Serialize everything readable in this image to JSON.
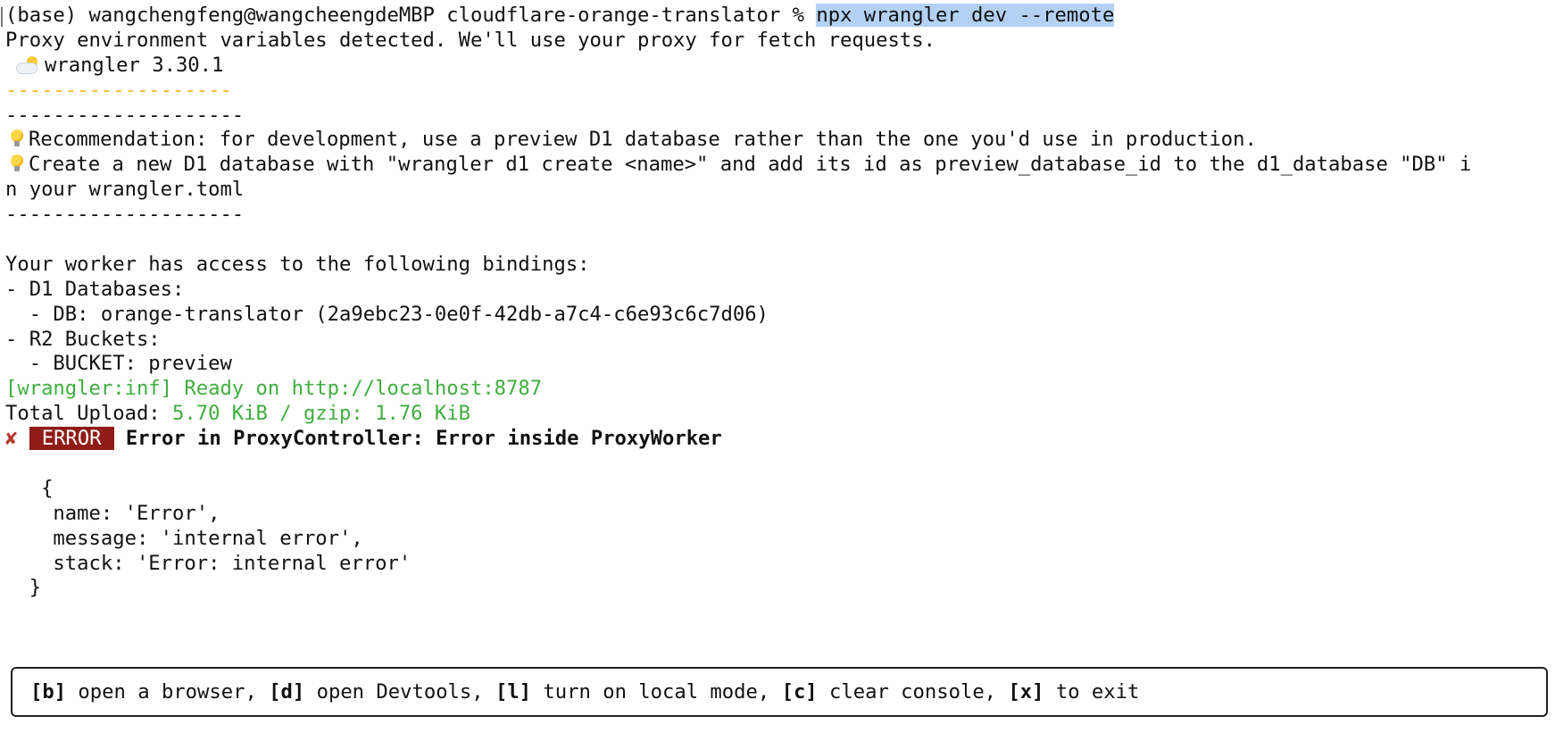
{
  "terminal": {
    "prompt": "(base) wangchengfeng@wangcheengdeMBP cloudflare-orange-translator % ",
    "command": "npx wrangler dev --remote",
    "proxy_notice": "Proxy environment variables detected. We'll use your proxy for fetch requests.",
    "wrangler_version": "wrangler 3.30.1",
    "divider_orange": "-------------------",
    "divider": "--------------------",
    "recommendation_1": "Recommendation: for development, use a preview D1 database rather than the one you'd use in production.",
    "recommendation_2a": "Create a new D1 database with \"wrangler d1 create <name>\" and add its id as preview_database_id to the d1_database \"DB\" i",
    "recommendation_2b": "n your wrangler.toml",
    "bindings_heading": "Your worker has access to the following bindings:",
    "d1_heading": "- D1 Databases:",
    "d1_item": "  - DB: orange-translator (2a9ebc23-0e0f-42db-a7c4-c6e93c6c7d06)",
    "r2_heading": "- R2 Buckets:",
    "r2_item": "  - BUCKET: preview",
    "ready_line": "[wrangler:inf] Ready on http://localhost:8787",
    "upload_label": "Total Upload: ",
    "upload_value": "5.70 KiB / gzip: 1.76 KiB",
    "error_mark": "✘",
    "error_badge": "ERROR",
    "error_message": "Error in ProxyController: Error inside ProxyWorker",
    "obj_open": "   {",
    "obj_name": "    name: 'Error',",
    "obj_message": "    message: 'internal error',",
    "obj_stack": "    stack: 'Error: internal error'",
    "obj_close": "  }"
  },
  "shortcuts": [
    {
      "key": "[b]",
      "label": " open a browser, "
    },
    {
      "key": "[d]",
      "label": " open Devtools, "
    },
    {
      "key": "[l]",
      "label": " turn on local mode, "
    },
    {
      "key": "[c]",
      "label": " clear console, "
    },
    {
      "key": "[x]",
      "label": " to exit"
    }
  ],
  "colors": {
    "selection": "#b3d1f3",
    "divider_orange": "#f5b528",
    "success_green": "#3fae3f",
    "error_badge": "#8f1c17",
    "error_mark": "#b33a2a"
  },
  "icons": {
    "version_icon": "sun-behind-cloud-icon",
    "tip_icon": "light-bulb-icon"
  }
}
